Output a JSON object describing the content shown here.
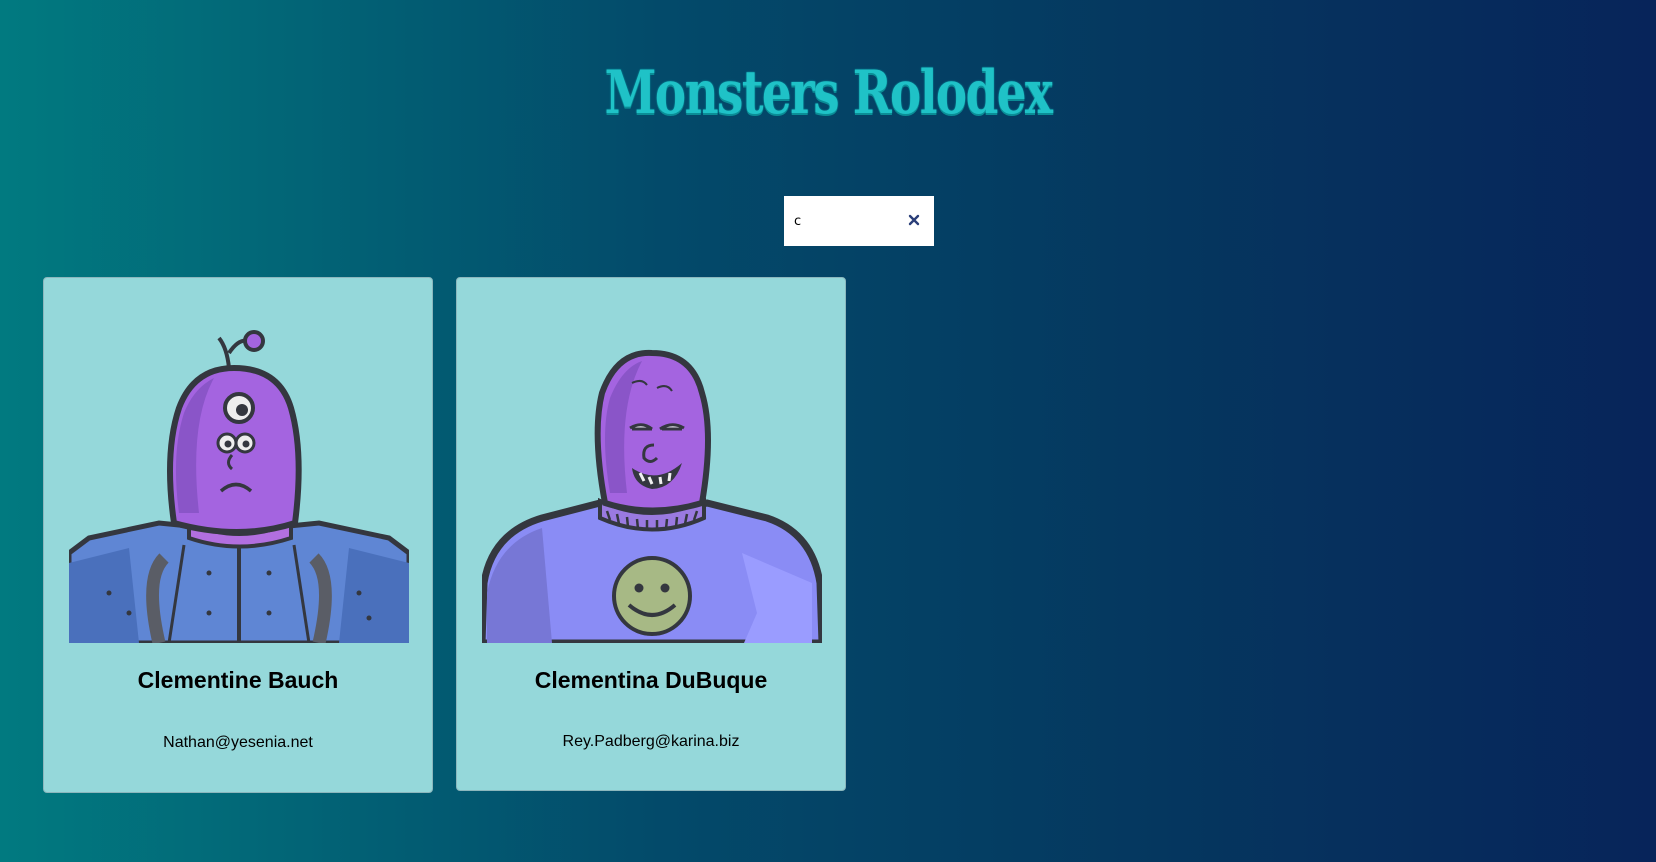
{
  "app": {
    "title": "Monsters Rolodex"
  },
  "search": {
    "value": "c",
    "clear_icon": "close-icon"
  },
  "monsters": [
    {
      "name": "Clementine Bauch",
      "email": "Nathan@yesenia.net",
      "avatar_icon": "cyclops-robot-monster-avatar"
    },
    {
      "name": "Clementina DuBuque",
      "email": "Rey.Padberg@karina.biz",
      "avatar_icon": "smiley-shirt-monster-avatar"
    }
  ],
  "colors": {
    "title": "#1fc2c7",
    "card_bg": "#95d8da",
    "monster_skin": "#a464e0",
    "gradient_start": "#017a80",
    "gradient_end": "#07245a"
  }
}
